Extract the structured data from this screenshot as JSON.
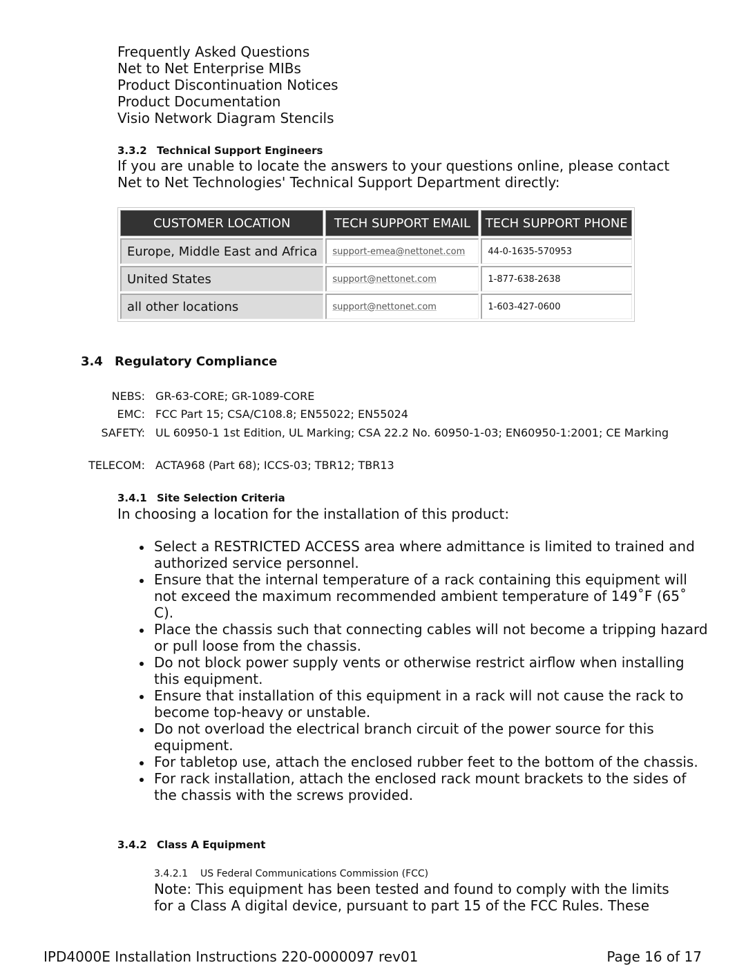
{
  "links": [
    "Frequently Asked Questions",
    "Net to Net Enterprise MIBs",
    "Product Discontinuation Notices",
    "Product Documentation",
    "Visio Network Diagram Stencils"
  ],
  "section_332": {
    "number": "3.3.2",
    "title": "Technical Support Engineers",
    "text_line1": "If you are unable to locate the answers to your questions online, please contact",
    "text_line2": "Net to Net Technologies' Technical Support Department directly:"
  },
  "support_table": {
    "headers": [
      "CUSTOMER LOCATION",
      "TECH SUPPORT EMAIL",
      "TECH SUPPORT PHONE"
    ],
    "rows": [
      {
        "location": "Europe, Middle East and Africa",
        "email": "support-emea@nettonet.com",
        "phone": "44-0-1635-570953"
      },
      {
        "location": "United States",
        "email": "support@nettonet.com",
        "phone": "1-877-638-2638"
      },
      {
        "location": "all other locations",
        "email": "support@nettonet.com",
        "phone": "1-603-427-0600"
      }
    ]
  },
  "section_34": {
    "number": "3.4",
    "title": "Regulatory Compliance",
    "items": [
      {
        "label": "NEBS:",
        "value": "GR-63-CORE; GR-1089-CORE"
      },
      {
        "label": "EMC:",
        "value": "FCC Part 15; CSA/C108.8; EN55022; EN55024"
      },
      {
        "label": "SAFETY:",
        "value": "UL 60950-1 1st Edition, UL Marking; CSA 22.2 No. 60950-1-03; EN60950-1:2001; CE Marking"
      },
      {
        "label": "TELECOM:",
        "value": "ACTA968 (Part 68); ICCS-03; TBR12; TBR13"
      }
    ]
  },
  "section_341": {
    "number": "3.4.1",
    "title": "Site Selection Criteria",
    "intro": "In choosing a location for the installation of this product:",
    "bullets": [
      "Select a RESTRICTED ACCESS area where admittance is limited to trained and authorized service personnel.",
      "Ensure that the internal temperature of a rack containing this equipment will not exceed the maximum recommended ambient temperature of 149˚F (65˚ C).",
      "Place the chassis such that connecting cables will not become a tripping hazard or pull loose from the chassis.",
      "Do not block power supply vents or otherwise restrict airflow when installing this equipment.",
      "Ensure that installation of this equipment in a rack will not cause the rack to become top-heavy or unstable.",
      "Do not overload the electrical branch circuit of the power source for this equipment.",
      "For tabletop use, attach the enclosed rubber feet to the bottom of the chassis.",
      "For rack installation, attach the enclosed rack mount brackets to the sides of the chassis with the screws provided."
    ]
  },
  "section_342": {
    "number": "3.4.2",
    "title": "Class A Equipment"
  },
  "section_3421": {
    "number": "3.4.2.1",
    "title": "US Federal Communications Commission (FCC)",
    "text_line1": "Note: This equipment has been tested and found to comply with the limits",
    "text_line2": "for a Class A digital device, pursuant to part 15 of the FCC Rules. These"
  },
  "footer": {
    "doc_title": "IPD4000E Installation Instructions 220-0000097 rev01",
    "page": "Page 16 of 17"
  }
}
